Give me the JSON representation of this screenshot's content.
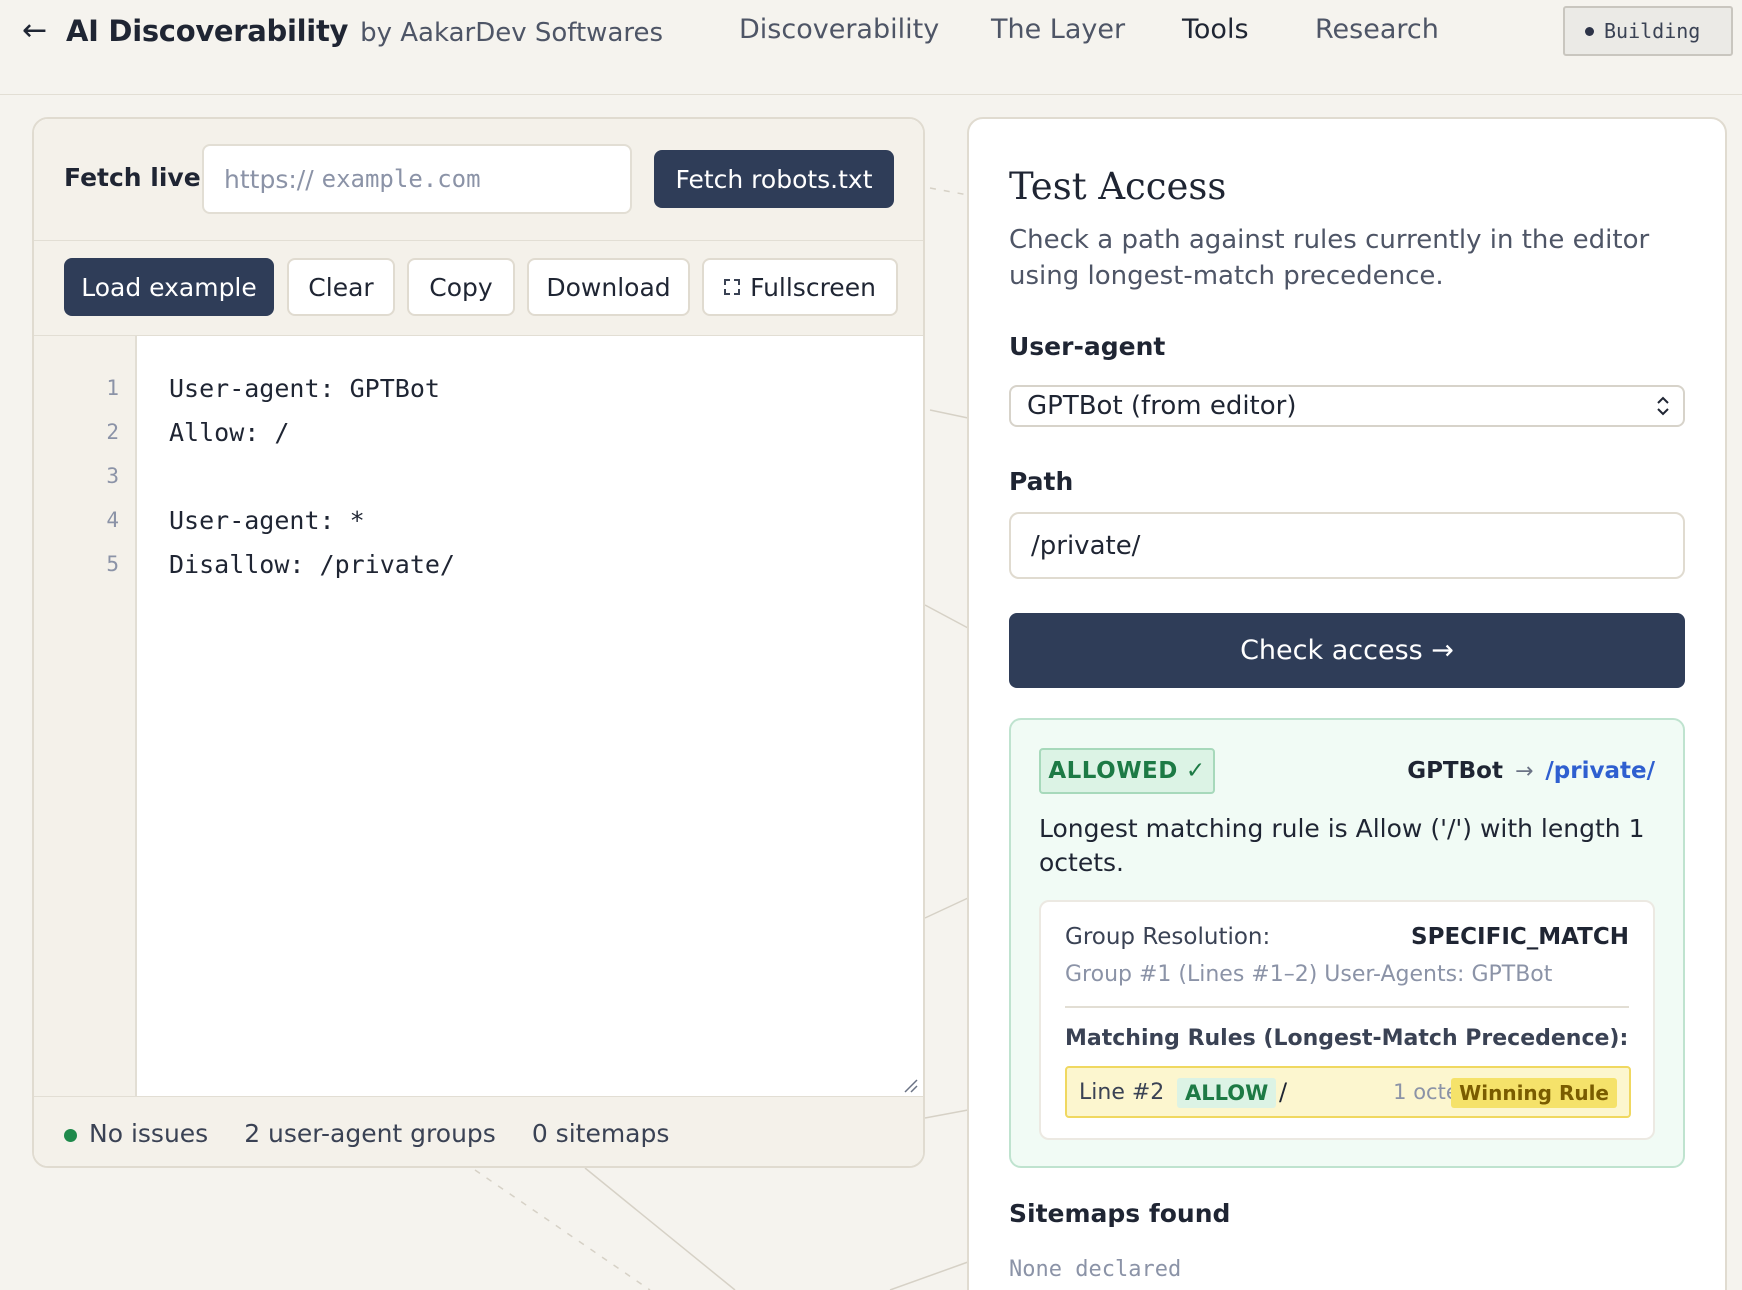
{
  "header": {
    "back_icon": "arrow-left-icon",
    "brand_name": "AI Discoverability",
    "brand_by": "by AakarDev Softwares",
    "nav": [
      {
        "label": "Discoverability",
        "active": false
      },
      {
        "label": "The Layer",
        "active": false
      },
      {
        "label": "Tools",
        "active": true
      },
      {
        "label": "Research",
        "active": false
      }
    ],
    "status_label": "Building"
  },
  "fetch": {
    "label": "Fetch live",
    "url_scheme": "https://",
    "url_placeholder": "example.com",
    "button_label": "Fetch robots.txt"
  },
  "toolbar": {
    "load_example": "Load example",
    "clear": "Clear",
    "copy": "Copy",
    "download": "Download",
    "fullscreen": "Fullscreen",
    "fullscreen_icon": "fullscreen-icon"
  },
  "editor": {
    "lines": [
      {
        "no": "1",
        "text": "User-agent: GPTBot"
      },
      {
        "no": "2",
        "text": "Allow: /"
      },
      {
        "no": "3",
        "text": ""
      },
      {
        "no": "4",
        "text": "User-agent: *"
      },
      {
        "no": "5",
        "text": "Disallow: /private/"
      }
    ]
  },
  "status_bar": {
    "issues": "No issues",
    "groups": "2 user-agent groups",
    "sitemaps": "0 sitemaps",
    "ok_color": "#1f8a4c"
  },
  "test_access": {
    "title": "Test Access",
    "description": "Check a path against rules currently in the editor using longest-match precedence.",
    "user_agent_label": "User-agent",
    "user_agent_value": "GPTBot (from editor)",
    "path_label": "Path",
    "path_value": "/private/",
    "check_button": "Check access →"
  },
  "result": {
    "verdict": "ALLOWED",
    "verdict_icon": "check-icon",
    "agent": "GPTBot",
    "arrow": "→",
    "path": "/private/",
    "message": "Longest matching rule is Allow ('/') with length 1 octets.",
    "group_resolution_label": "Group Resolution:",
    "group_resolution_value": "SPECIFIC_MATCH",
    "group_detail": "Group #1 (Lines #1–2) User-Agents: GPTBot",
    "matching_rules_label": "Matching Rules (Longest-Match Precedence):",
    "rule": {
      "line": "Line #2",
      "type": "ALLOW",
      "path": "/",
      "size": "1 octet",
      "tag": "Winning Rule"
    },
    "colors": {
      "allowed": "#1d7a45",
      "winning": "#f5e26a",
      "accent": "#2f3d58"
    }
  },
  "sitemaps": {
    "title": "Sitemaps found",
    "value": "None declared"
  }
}
